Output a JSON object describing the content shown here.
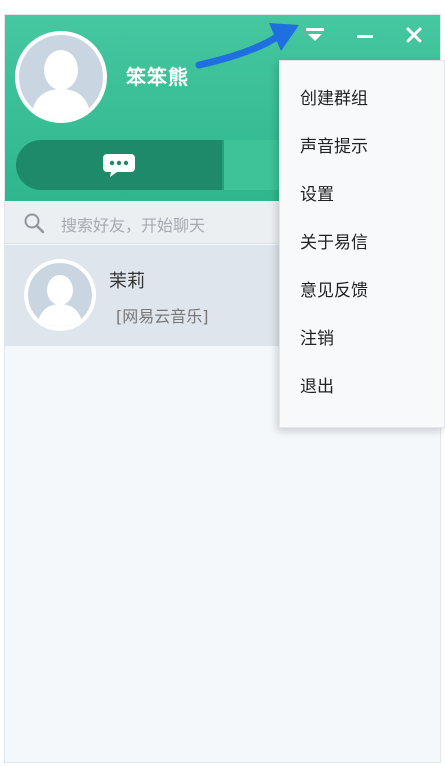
{
  "profile": {
    "username": "笨笨熊"
  },
  "window_controls": {
    "menu_icon": "menu-caret-icon",
    "minimize_icon": "minimize-icon",
    "close_icon": "close-icon"
  },
  "tabs": [
    {
      "icon": "chat-bubble-icon",
      "active": true
    },
    {
      "icon": "contacts-icon",
      "active": false
    }
  ],
  "search": {
    "placeholder": "搜索好友，开始聊天"
  },
  "contacts": [
    {
      "name": "茉莉",
      "status": "[网易云音乐]"
    }
  ],
  "menu": {
    "items": [
      {
        "label": "创建群组"
      },
      {
        "label": "声音提示"
      },
      {
        "label": "设置"
      },
      {
        "label": "关于易信"
      },
      {
        "label": "意见反馈"
      },
      {
        "label": "注销"
      },
      {
        "label": "退出"
      }
    ]
  },
  "colors": {
    "header": "#3cbf96",
    "tab_active": "#1e8a69",
    "arrow": "#1f6fe0"
  }
}
